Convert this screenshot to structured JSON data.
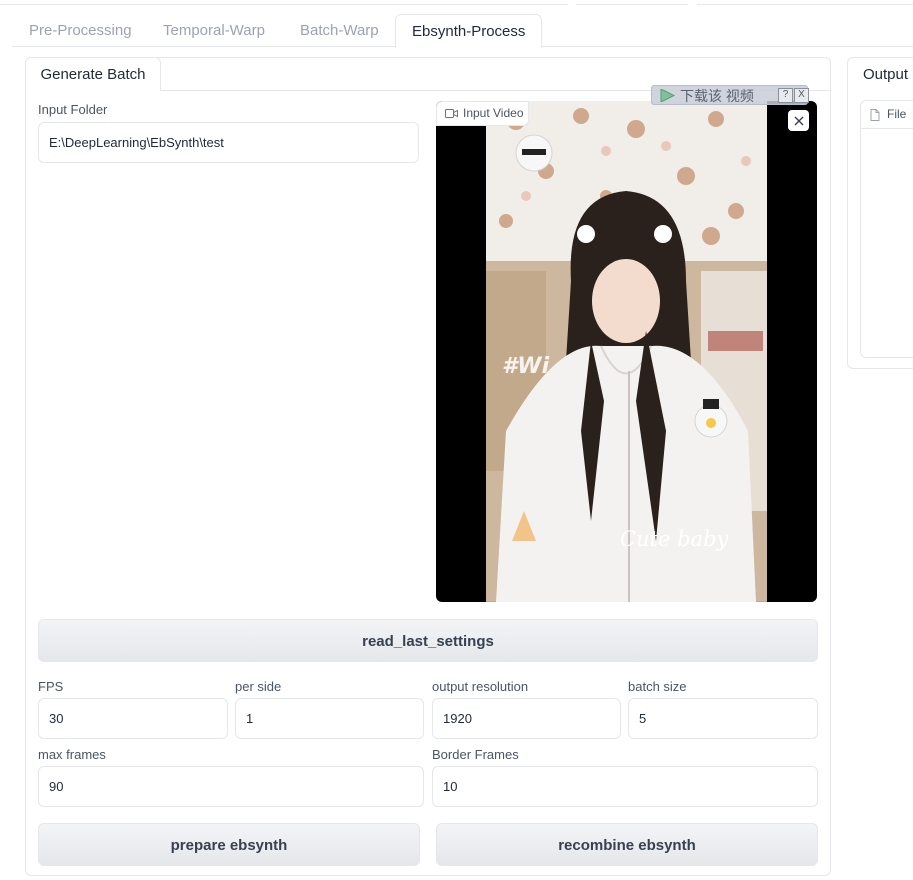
{
  "top_tabs": [
    "Pre-Processing",
    "Temporal-Warp",
    "Batch-Warp",
    "Ebsynth-Process"
  ],
  "active_top_tab": "Ebsynth-Process",
  "sub_tab": "Generate Batch",
  "input_folder": {
    "label": "Input Folder",
    "value": "E:\\DeepLearning\\EbSynth\\test"
  },
  "video": {
    "label": "Input Video",
    "overlay_text": "#Wi",
    "caption": "Cute baby",
    "download_banner": "下载该 视频",
    "banner_help": "?",
    "banner_close": "X"
  },
  "buttons": {
    "read_settings": "read_last_settings",
    "prepare": "prepare ebsynth",
    "recombine": "recombine ebsynth"
  },
  "fields": {
    "fps": {
      "label": "FPS",
      "value": "30"
    },
    "per_side": {
      "label": "per side",
      "value": "1"
    },
    "output_resolution": {
      "label": "output resolution",
      "value": "1920"
    },
    "batch_size": {
      "label": "batch size",
      "value": "5"
    },
    "max_frames": {
      "label": "max frames",
      "value": "90"
    },
    "border_frames": {
      "label": "Border Frames",
      "value": "10"
    }
  },
  "output": {
    "title": "Output",
    "file_label": "File"
  },
  "icons": {
    "video_icon": "video-camera-icon",
    "close_icon": "close-icon",
    "file_icon": "file-icon",
    "play_icon": "play-icon"
  }
}
